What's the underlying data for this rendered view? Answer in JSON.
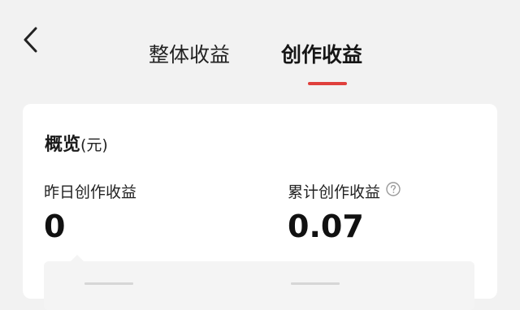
{
  "header": {
    "back_icon": "chevron-left-icon",
    "tabs": [
      {
        "label": "整体收益",
        "active": false
      },
      {
        "label": "创作收益",
        "active": true
      }
    ],
    "indicator_color": "#e0403c"
  },
  "overview": {
    "title": "概览",
    "unit": "(元)",
    "yesterday": {
      "label": "昨日创作收益",
      "value": "0"
    },
    "total": {
      "label": "累计创作收益",
      "value": "0.07",
      "help_icon": "question-circle-icon"
    }
  }
}
